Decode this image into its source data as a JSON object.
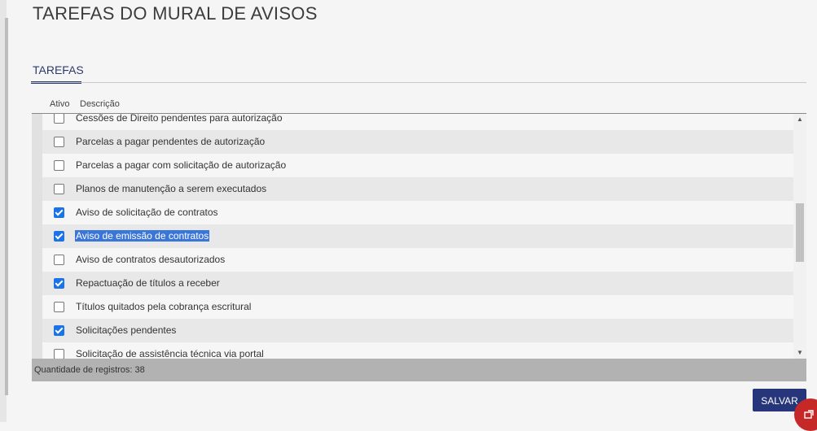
{
  "page": {
    "title": "TAREFAS DO MURAL DE AVISOS"
  },
  "tabs": [
    {
      "label": "TAREFAS",
      "active": true
    }
  ],
  "grid": {
    "columns": [
      "Ativo",
      "Descrição"
    ],
    "rows": [
      {
        "ativo": false,
        "descricao": "Cessões de Direito pendentes para autorização"
      },
      {
        "ativo": false,
        "descricao": "Parcelas a pagar pendentes de autorização"
      },
      {
        "ativo": false,
        "descricao": "Parcelas a pagar com solicitação de autorização"
      },
      {
        "ativo": false,
        "descricao": "Planos de manutenção a serem executados"
      },
      {
        "ativo": true,
        "descricao": "Aviso de solicitação de contratos"
      },
      {
        "ativo": true,
        "descricao": "Aviso de emissão de contratos",
        "selected": true
      },
      {
        "ativo": false,
        "descricao": "Aviso de contratos desautorizados"
      },
      {
        "ativo": true,
        "descricao": "Repactuação de títulos a receber"
      },
      {
        "ativo": false,
        "descricao": "Títulos quitados pela cobrança escritural"
      },
      {
        "ativo": true,
        "descricao": "Solicitações pendentes"
      },
      {
        "ativo": false,
        "descricao": "Solicitação de assistência técnica via portal"
      }
    ],
    "footer": "Quantidade de registros: 38"
  },
  "actions": {
    "save_label": "SALVAR"
  },
  "colors": {
    "accent": "#27357a",
    "checkbox": "#1a73e8",
    "selection": "#3a76d8",
    "badge": "#c62828"
  },
  "icons": {
    "scroll_up": "triangle-up-icon",
    "scroll_down": "triangle-down-icon",
    "badge": "feedback-icon"
  }
}
